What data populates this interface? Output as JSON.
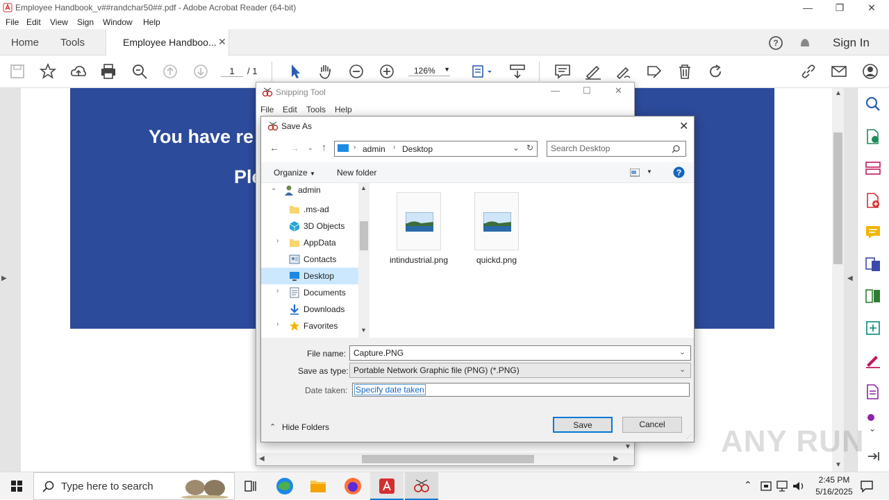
{
  "app": {
    "window_title": "Employee Handbook_v##randchar50##.pdf - Adobe Acrobat Reader (64-bit)",
    "menu": [
      "File",
      "Edit",
      "View",
      "Sign",
      "Window",
      "Help"
    ],
    "tabs": {
      "home": "Home",
      "tools": "Tools",
      "document": "Employee Handboo..."
    },
    "sign_in": "Sign In",
    "page_current": "1",
    "page_total": "/ 1",
    "zoom": "126%",
    "banner_line1": "You have re",
    "banner_line2": "Ple",
    "accent_color": "#2d4b9b"
  },
  "snipping_tool": {
    "title": "Snipping Tool",
    "menu": [
      "File",
      "Edit",
      "Tools",
      "Help"
    ]
  },
  "save_as": {
    "title": "Save As",
    "breadcrumb": [
      "admin",
      "Desktop"
    ],
    "search_placeholder": "Search Desktop",
    "organize": "Organize",
    "new_folder": "New folder",
    "tree": [
      {
        "label": "admin",
        "icon": "user-icon",
        "expand": "v"
      },
      {
        "label": ".ms-ad",
        "icon": "folder-icon",
        "expand": ""
      },
      {
        "label": "3D Objects",
        "icon": "cube-icon",
        "expand": ""
      },
      {
        "label": "AppData",
        "icon": "folder-icon",
        "expand": ">"
      },
      {
        "label": "Contacts",
        "icon": "contacts-icon",
        "expand": ""
      },
      {
        "label": "Desktop",
        "icon": "desktop-icon",
        "expand": "",
        "selected": true
      },
      {
        "label": "Documents",
        "icon": "documents-icon",
        "expand": ">"
      },
      {
        "label": "Downloads",
        "icon": "download-icon",
        "expand": ""
      },
      {
        "label": "Favorites",
        "icon": "star-icon",
        "expand": ">"
      }
    ],
    "files": [
      "intindustrial.png",
      "quickd.png"
    ],
    "file_name_label": "File name:",
    "file_name_value": "Capture.PNG",
    "save_type_label": "Save as type:",
    "save_type_value": "Portable Network Graphic file (PNG) (*.PNG)",
    "date_taken_label": "Date taken:",
    "date_taken_placeholder": "Specify date taken",
    "hide_folders": "Hide Folders",
    "save_button": "Save",
    "cancel_button": "Cancel"
  },
  "taskbar": {
    "search_placeholder": "Type here to search",
    "time": "2:45 PM",
    "date": "5/16/2025"
  },
  "watermark": "ANY RUN"
}
